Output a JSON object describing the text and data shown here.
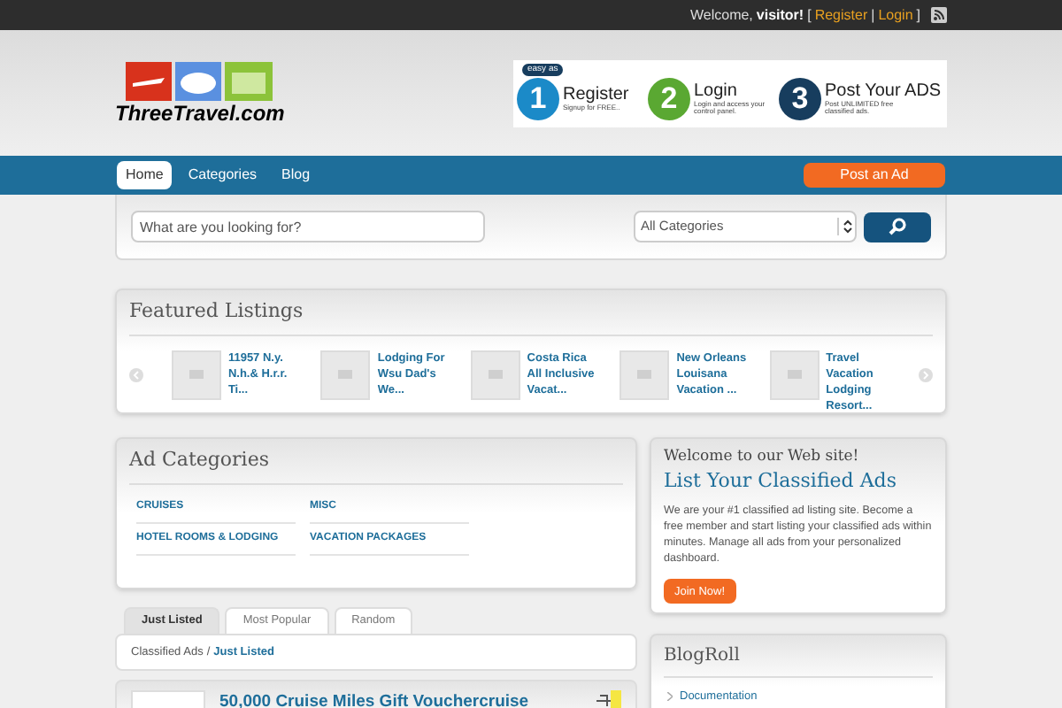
{
  "topbar": {
    "welcome": "Welcome,",
    "user": "visitor!",
    "open": "[",
    "register": "Register",
    "sep": "|",
    "login": "Login",
    "close": "]"
  },
  "logo": {
    "text": "ThreeTravel.com"
  },
  "banner": {
    "badge": "easy as",
    "steps": [
      {
        "number": "1",
        "title": "Register",
        "subtitle": "Signup for FREE..",
        "color": "#1b8ac8"
      },
      {
        "number": "2",
        "title": "Login",
        "subtitle": "Login and access your control panel.",
        "color": "#5aa832"
      },
      {
        "number": "3",
        "title": "Post Your ADS",
        "subtitle": "Post UNLIMITED free classified ads.",
        "color": "#173d5e"
      }
    ]
  },
  "nav": {
    "items": [
      {
        "label": "Home",
        "selected": true
      },
      {
        "label": "Categories",
        "selected": false
      },
      {
        "label": "Blog",
        "selected": false
      }
    ],
    "post_button": "Post an Ad"
  },
  "search": {
    "placeholder": "What are you looking for?",
    "category": "All Categories"
  },
  "featured": {
    "title": "Featured Listings",
    "items": [
      {
        "title": "11957 N.y. N.h.& H.r.r. Ti..."
      },
      {
        "title": "Lodging For Wsu Dad's We..."
      },
      {
        "title": "Costa Rica All Inclusive Vacat..."
      },
      {
        "title": "New Orleans Louisana Vacation ..."
      },
      {
        "title": "Travel Vacation Lodging Resort..."
      }
    ]
  },
  "categories": {
    "title": "Ad Categories",
    "items": [
      "CRUISES",
      "MISC",
      "HOTEL ROOMS & LODGING",
      "VACATION PACKAGES"
    ]
  },
  "welcome": {
    "heading": "Welcome to our Web site!",
    "title": "List Your Classified Ads",
    "text": "We are your #1 classified ad listing site. Become a free member and start listing your classified ads within minutes. Manage all ads from your personalized dashboard.",
    "button": "Join Now!"
  },
  "listing_tabs": [
    {
      "label": "Just Listed",
      "selected": true
    },
    {
      "label": "Most Popular",
      "selected": false
    },
    {
      "label": "Random",
      "selected": false
    }
  ],
  "breadcrumb": {
    "root": "Classified Ads",
    "sep": "/",
    "current": "Just Listed"
  },
  "listings": [
    {
      "title": "50,000 Cruise Miles Gift Vouchercruise"
    }
  ],
  "blogroll": {
    "title": "BlogRoll",
    "items": [
      "Documentation"
    ]
  }
}
